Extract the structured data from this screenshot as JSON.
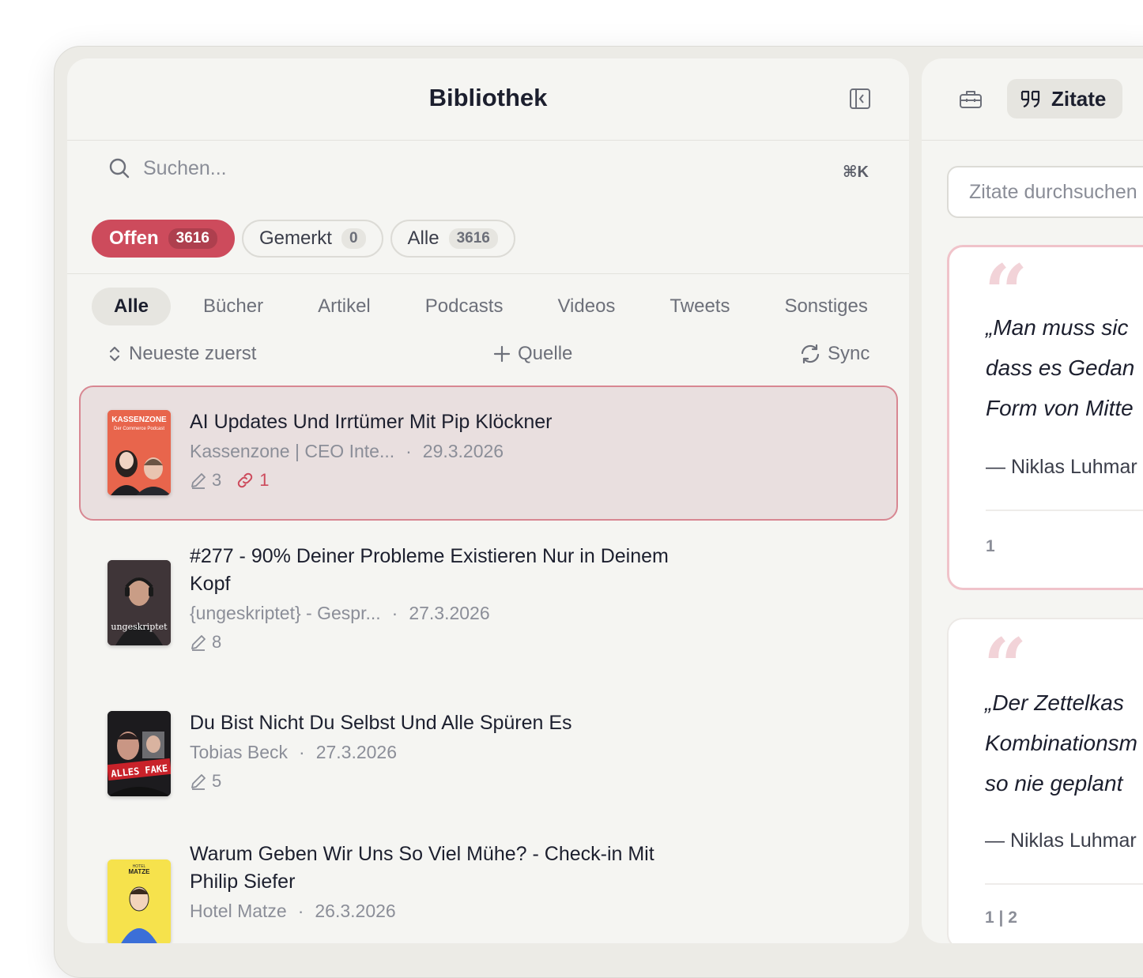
{
  "library": {
    "title": "Bibliothek",
    "search_placeholder": "Suchen...",
    "search_shortcut": "⌘K",
    "filters": [
      {
        "label": "Offen",
        "count": "3616"
      },
      {
        "label": "Gemerkt",
        "count": "0"
      },
      {
        "label": "Alle",
        "count": "3616"
      }
    ],
    "types": [
      "Alle",
      "Bücher",
      "Artikel",
      "Podcasts",
      "Videos",
      "Tweets",
      "Sonstiges"
    ],
    "sort_label": "Neueste zuerst",
    "add_source_label": "Quelle",
    "sync_label": "Sync",
    "items": [
      {
        "title": "AI Updates Und Irrtümer Mit Pip Klöckner",
        "author": "Kassenzone | CEO Inte...",
        "date": "29.3.2026",
        "highlights": "3",
        "links": "1",
        "cover_text": "KASSENZONE",
        "cover_sub": "Der Commerce Podcast"
      },
      {
        "title": "#277 - 90% Deiner Probleme Existieren Nur in Deinem Kopf",
        "author": "{ungeskriptet} - Gespr...",
        "date": "27.3.2026",
        "highlights": "8",
        "cover_text": "ungeskriptet"
      },
      {
        "title": "Du Bist Nicht Du Selbst Und Alle Spüren Es",
        "author": "Tobias Beck",
        "date": "27.3.2026",
        "highlights": "5",
        "cover_text": "ALLES FAKE"
      },
      {
        "title": "Warum Geben Wir Uns So Viel Mühe? - Check-in Mit Philip Siefer",
        "author": "Hotel Matze",
        "date": "26.3.2026",
        "cover_text": "MATZE",
        "cover_sub": "HOTEL"
      }
    ]
  },
  "quotes_panel": {
    "tab_label": "Zitate",
    "search_placeholder": "Zitate durchsuchen",
    "cards": [
      {
        "lines": [
          "„Man muss sic",
          "dass es Gedan",
          "Form von Mitte"
        ],
        "author": "— Niklas Luhmar",
        "page": "1"
      },
      {
        "lines": [
          "„Der Zettelkas",
          "Kombinationsm",
          "so nie geplant"
        ],
        "author": "— Niklas Luhmar",
        "page": "1 | 2"
      }
    ]
  },
  "colors": {
    "accent": "#cd4b5c",
    "panel": "#f5f5f2",
    "selected_bg": "#e9dfdf"
  }
}
